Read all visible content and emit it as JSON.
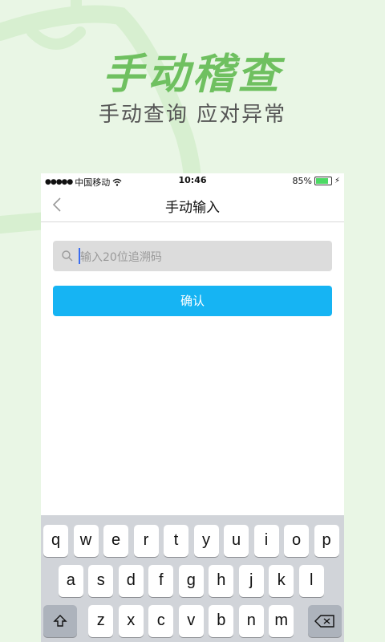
{
  "promo": {
    "title": "手动稽查",
    "subtitle": "手动查询  应对异常"
  },
  "status_bar": {
    "carrier": "中国移动",
    "time": "10:46",
    "battery": "85%",
    "battery_level": 0.85
  },
  "nav": {
    "title": "手动输入"
  },
  "search": {
    "placeholder": "输入20位追溯码"
  },
  "confirm_label": "确认",
  "keyboard": {
    "row1": [
      "q",
      "w",
      "e",
      "r",
      "t",
      "y",
      "u",
      "i",
      "o",
      "p"
    ],
    "row2": [
      "a",
      "s",
      "d",
      "f",
      "g",
      "h",
      "j",
      "k",
      "l"
    ],
    "row3": [
      "z",
      "x",
      "c",
      "v",
      "b",
      "n",
      "m"
    ]
  }
}
